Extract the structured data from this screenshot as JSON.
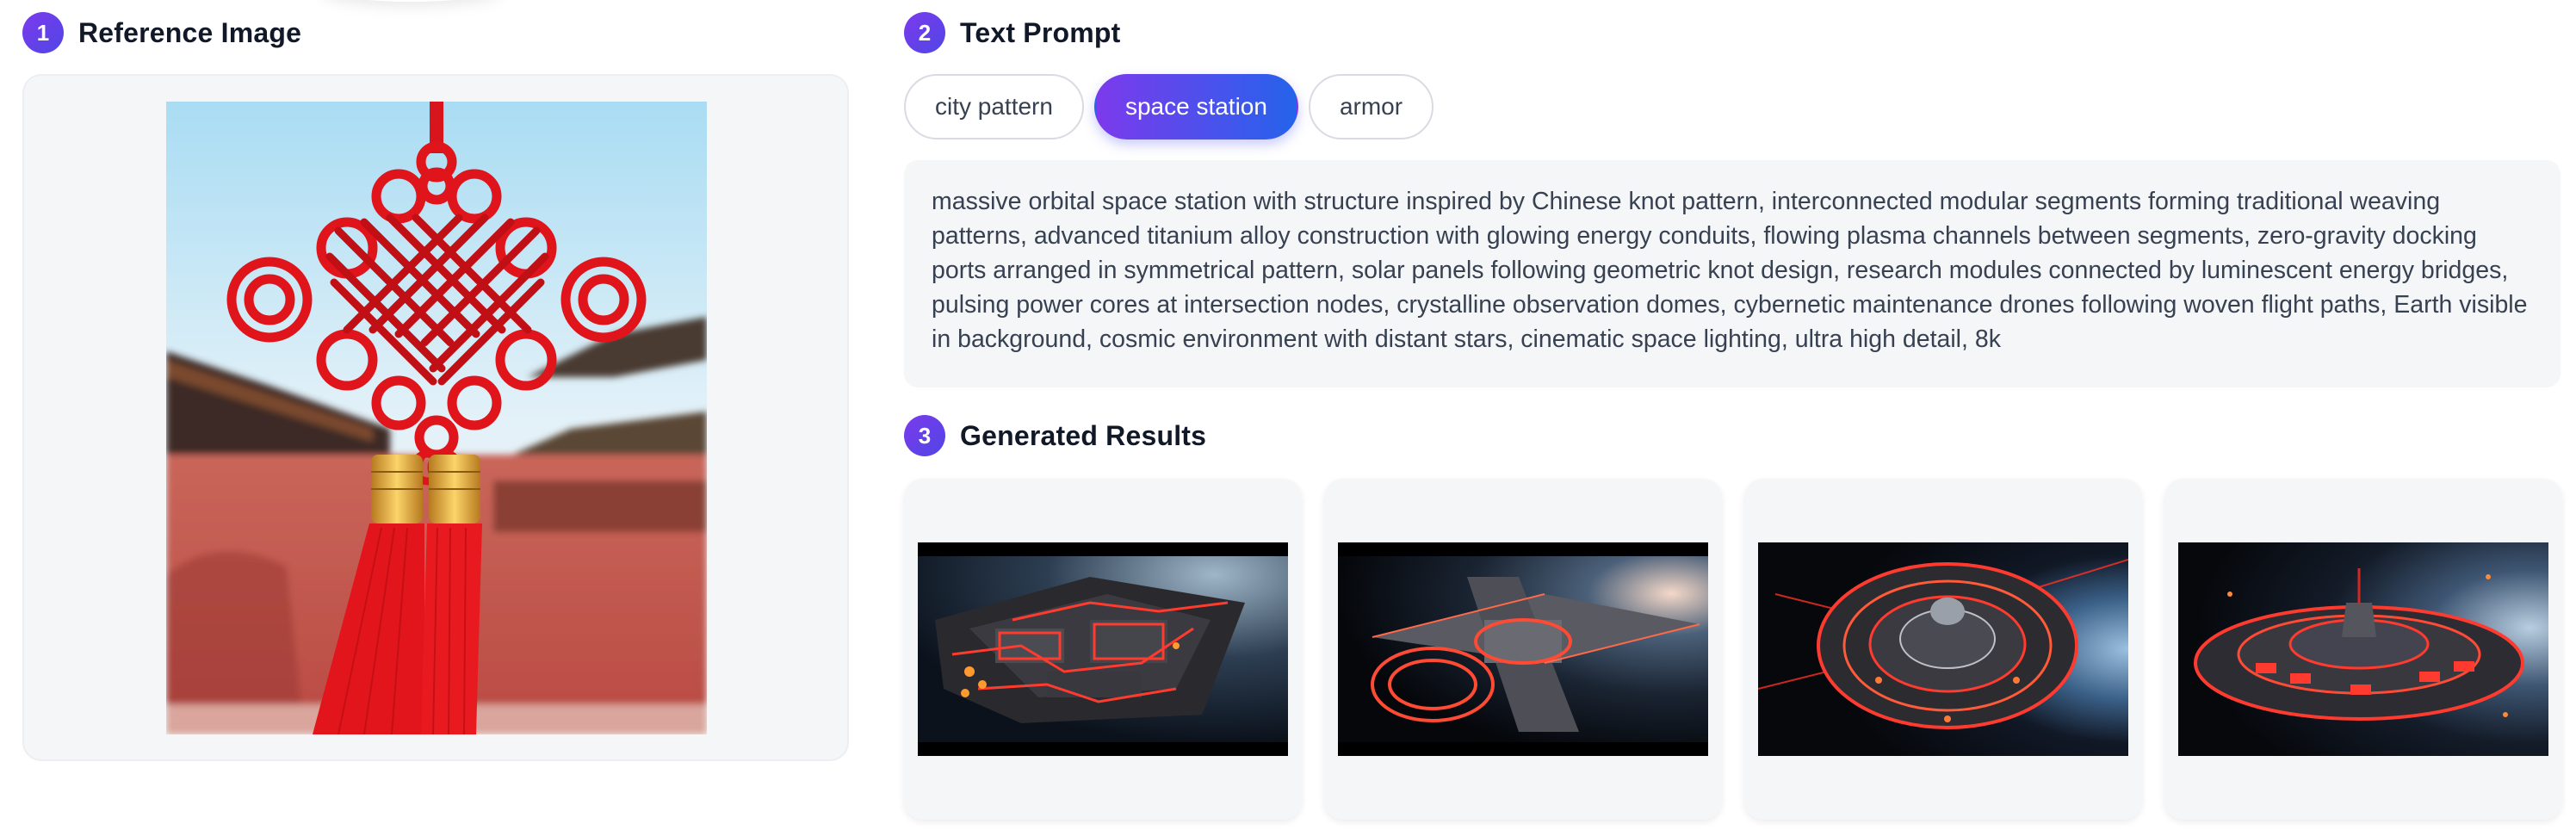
{
  "steps": {
    "reference": {
      "number": "1",
      "title": "Reference Image"
    },
    "prompt": {
      "number": "2",
      "title": "Text Prompt"
    },
    "results": {
      "number": "3",
      "title": "Generated Results"
    }
  },
  "reference_image": {
    "subject": "red Chinese knot with tassels in front of palace wall"
  },
  "prompt_chips": [
    {
      "label": "city pattern",
      "selected": false
    },
    {
      "label": "space station",
      "selected": true
    },
    {
      "label": "armor",
      "selected": false
    }
  ],
  "prompt_text": "massive orbital space station with structure inspired by Chinese knot pattern, interconnected modular segments forming traditional weaving patterns, advanced titanium alloy construction with glowing energy conduits, flowing plasma channels between segments, zero-gravity docking ports arranged in symmetrical pattern, solar panels following geometric knot design, research modules connected by luminescent energy bridges, pulsing power cores at intersection nodes, crystalline observation domes, cybernetic maintenance drones following woven flight paths, Earth visible in background, cosmic environment with distant stars, cinematic space lighting, ultra high detail, 8k",
  "results": [
    {
      "subject": "red glowing modular space station over Earth"
    },
    {
      "subject": "cross-shaped space station with glowing rings"
    },
    {
      "subject": "circular ring space station near Earth"
    },
    {
      "subject": "disc-shaped red space station"
    }
  ],
  "colors": {
    "accent_start": "#7c3aed",
    "accent_end": "#2563eb",
    "panel_bg": "#f5f6f8",
    "knot_red": "#e0141b"
  }
}
